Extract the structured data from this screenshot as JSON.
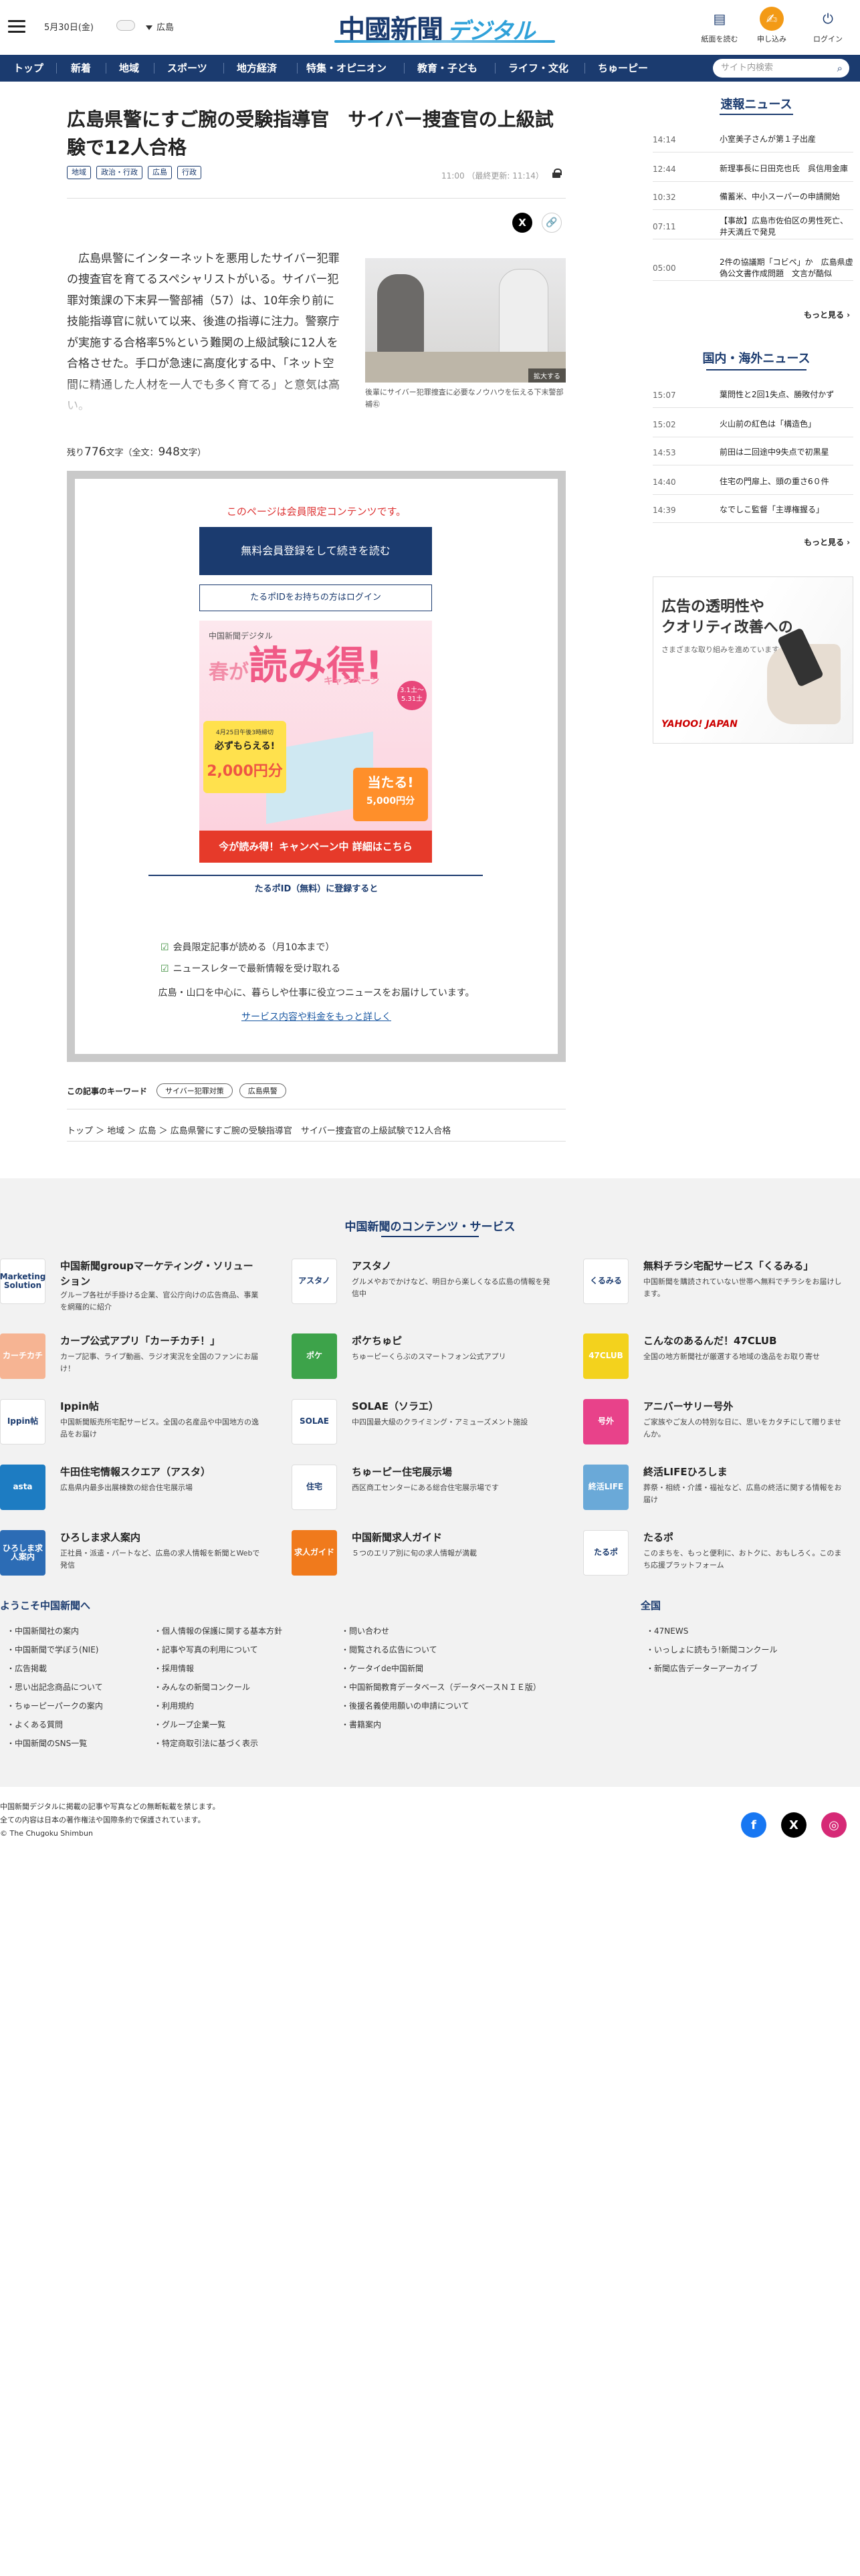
{
  "header": {
    "date": "5月30日(金)",
    "region": "広島",
    "logo_main": "中國新聞",
    "logo_sub": "デジタル",
    "buttons": [
      {
        "label": "紙面を読む",
        "icon": "newspaper-icon"
      },
      {
        "label": "申し込み",
        "icon": "apply-icon"
      },
      {
        "label": "ログイン",
        "icon": "power-icon"
      }
    ]
  },
  "nav": {
    "items": [
      "トップ",
      "新着",
      "地域",
      "スポーツ",
      "地方経済",
      "特集・オピニオン",
      "教育・子ども",
      "ライフ・文化",
      "ちゅーピー"
    ],
    "search_placeholder": "サイト内検索"
  },
  "article": {
    "title": "広島県警にすご腕の受験指導官　サイバー捜査官の上級試験で12人合格",
    "tags": [
      "地域",
      "政治・行政",
      "広島",
      "行政"
    ],
    "time": "11:00 （最終更新: 11:14）",
    "body": "広島県警にインターネットを悪用したサイバー犯罪の捜査官を育てるスペシャリストがいる。サイバー犯罪対策課の下末昇一警部補（57）は、10年余り前に技能指導官に就いて以来、後進の指導に注力。警察庁が実施する合格率5%という難関の上級試験に12人を合格させた。手口が急速に高度化する中、「ネット空間に精通した人材を一人でも多く育てる」と意気は高い。",
    "photo_zoom": "拡大する",
    "photo_caption": "後輩にサイバー犯罪捜査に必要なノウハウを伝える下末警部補㊨",
    "remaining_prefix": "残り",
    "remaining_chars": "776",
    "remaining_mid": "文字（全文：",
    "total_chars": "948",
    "remaining_suffix": "文字）"
  },
  "paywall": {
    "notice": "このページは会員限定コンテンツです。",
    "register_button": "無料会員登録をして続きを読む",
    "login_button": "たるポIDをお持ちの方はログイン",
    "campaign": {
      "brand": "中国新聞デジタル",
      "headline": "読み得!",
      "prefix": "春が",
      "sub": "キャンペーン",
      "dates": "3.1土〜5.31土",
      "gift_note": "4月25日午後3時締切",
      "gift_title": "必ずもらえる!",
      "gift_amount": "2,000円分",
      "lottery_title": "当たる!",
      "lottery_amount": "5,000円分"
    },
    "cta_button": "今が読み得！キャンペーン中 詳細はこちら",
    "benefits_heading": "たるポID（無料）に登録すると",
    "benefits": [
      "会員限定記事が読める（月10本まで）",
      "ニュースレターで最新情報を受け取れる"
    ],
    "benefits_text": "広島・山口を中心に、暮らしや仕事に役立つニュースをお届けしています。",
    "more_link": "サービス内容や料金をもっと詳しく"
  },
  "keywords": {
    "label": "この記事のキーワード",
    "items": [
      "サイバー犯罪対策",
      "広島県警"
    ]
  },
  "breadcrumb": "トップ ＞ 地域 ＞ 広島 ＞ 広島県警にすご腕の受験指導官　サイバー捜査官の上級試験で12人合格",
  "sidebar": {
    "flash": {
      "heading": "速報ニュース",
      "items": [
        {
          "time": "14:14",
          "text": "小室美子さんが第１子出産"
        },
        {
          "time": "12:44",
          "text": "新理事長に日田克也氏　呉信用金庫"
        },
        {
          "time": "10:32",
          "text": "備蓄米、中小スーパーの申請開始"
        },
        {
          "time": "07:11",
          "text": "【事故】広島市佐伯区の男性死亡、井天満丘で発見"
        },
        {
          "time": "05:00",
          "text": "2件の協議期「コビペ」か　広島県虚偽公文書作成問題　文言が酷似"
        }
      ],
      "more": "もっと見る ›"
    },
    "national": {
      "heading": "国内・海外ニュース",
      "items": [
        {
          "time": "15:07",
          "text": "葉問性と2回1失点、勝敗付かず"
        },
        {
          "time": "15:02",
          "text": "火山前の紅色は「構造色」"
        },
        {
          "time": "14:53",
          "text": "前田は二回途中9失点で初黒星"
        },
        {
          "time": "14:40",
          "text": "住宅の門扉上、頭の重さ6０件"
        },
        {
          "time": "14:39",
          "text": "なでしこ監督「主導権握る」"
        }
      ],
      "more": "もっと見る ›"
    },
    "ad": {
      "line1": "広告の透明性や",
      "line2": "クオリティ改善への",
      "line3": "さまざまな取り組みを進めています。",
      "brand": "YAHOO! JAPAN"
    }
  },
  "footer": {
    "heading": "中国新聞のコンテンツ・サービス",
    "services": [
      {
        "name": "中国新聞groupマーケティング・ソリューション",
        "desc": "グループ各社が手掛ける企業、官公庁向けの広告商品、事業を網羅的に紹介",
        "logo": "Marketing Solution",
        "color": "#ffffff"
      },
      {
        "name": "アスタノ",
        "desc": "グルメやおでかけなど、明日から楽しくなる広島の情報を発信中",
        "logo": "アスタノ",
        "color": "#ffffff"
      },
      {
        "name": "無料チラシ宅配サービス「くるみる」",
        "desc": "中国新聞を購読されていない世帯へ無料でチラシをお届けします。",
        "logo": "くるみる",
        "color": "#ffffff"
      },
      {
        "name": "カープ公式アプリ「カーチカチ！」",
        "desc": "カープ記事、ライブ動画、ラジオ実況を全国のファンにお届け！",
        "logo": "カーチカチ",
        "color": "#f6b493"
      },
      {
        "name": "ポケちゅピ",
        "desc": "ちゅーピーくらぶのスマートフォン公式アプリ",
        "logo": "ポケ",
        "color": "#3da34a"
      },
      {
        "name": "こんなのあるんだ！47CLUB",
        "desc": "全国の地方新聞社が厳選する地域の逸品をお取り寄せ",
        "logo": "47CLUB",
        "color": "#f3d21d"
      },
      {
        "name": "Ippin帖",
        "desc": "中国新聞販売所宅配サービス。全国の名産品や中国地方の逸品をお届け",
        "logo": "Ippin帖",
        "color": "#ffffff"
      },
      {
        "name": "SOLAE（ソラエ）",
        "desc": "中四国最大級のクライミング・アミューズメント施設",
        "logo": "SOLAE",
        "color": "#ffffff"
      },
      {
        "name": "アニバーサリー号外",
        "desc": "ご家族やご友人の特別な日に、思いをカタチにして贈りませんか。",
        "logo": "号外",
        "color": "#e8428a"
      },
      {
        "name": "牛田住宅情報スクエア（アスタ）",
        "desc": "広島県内最多出展棟数の総合住宅展示場",
        "logo": "asta",
        "color": "#1d7cc2"
      },
      {
        "name": "ちゅーピー住宅展示場",
        "desc": "西区商工センターにある総合住宅展示場です",
        "logo": "住宅",
        "color": "#ffffff"
      },
      {
        "name": "終活LIFEひろしま",
        "desc": "葬祭・相続・介護・福祉など、広島の終活に関する情報をお届け",
        "logo": "終活LIFE",
        "color": "#6aa9d8"
      },
      {
        "name": "ひろしま求人案内",
        "desc": "正社員・派遣・パートなど、広島の求人情報を新聞とWebで発信",
        "logo": "ひろしま求人案内",
        "color": "#2c6cb5"
      },
      {
        "name": "中国新聞求人ガイド",
        "desc": "５つのエリア別に旬の求人情報が満載",
        "logo": "求人ガイド",
        "color": "#f07a1c"
      },
      {
        "name": "たるポ",
        "desc": "このまちを、もっと便利に、おトクに、おもしろく。このまち応援プラットフォーム",
        "logo": "たるポ",
        "color": "#ffffff"
      }
    ],
    "welcome_heading": "ようこそ中国新聞へ",
    "national_heading": "全国",
    "links_col1": [
      "中国新聞社の案内",
      "中国新聞で学ぼう(NIE)",
      "広告掲載",
      "思い出記念商品について",
      "ちゅーピーパークの案内",
      "よくある質問",
      "中国新聞のSNS一覧"
    ],
    "links_col2": [
      "個人情報の保護に関する基本方針",
      "記事や写真の利用について",
      "採用情報",
      "みんなの新聞コンクール",
      "利用規約",
      "グループ企業一覧",
      "特定商取引法に基づく表示"
    ],
    "links_col3": [
      "問い合わせ",
      "閲覧される広告について",
      "ケータイde中国新聞",
      "中国新聞教育データベース（データベースＮＩＥ版）",
      "後援名義使用願いの申請について",
      "書籍案内"
    ],
    "links_col4": [
      "47NEWS",
      "いっしょに読もう!新聞コンクール",
      "新聞広告データーアーカイブ"
    ],
    "copyright1": "中国新聞デジタルに掲載の記事や写真などの無断転載を禁じます。",
    "copyright2": "全ての内容は日本の著作権法や国際条約で保護されています。",
    "copyright3": "© The Chugoku Shimbun",
    "social": [
      {
        "name": "facebook-icon",
        "color": "#1877f2",
        "glyph": "f"
      },
      {
        "name": "x-icon",
        "color": "#000000",
        "glyph": "X"
      },
      {
        "name": "instagram-icon",
        "color": "#d62976",
        "glyph": "◎"
      }
    ]
  }
}
